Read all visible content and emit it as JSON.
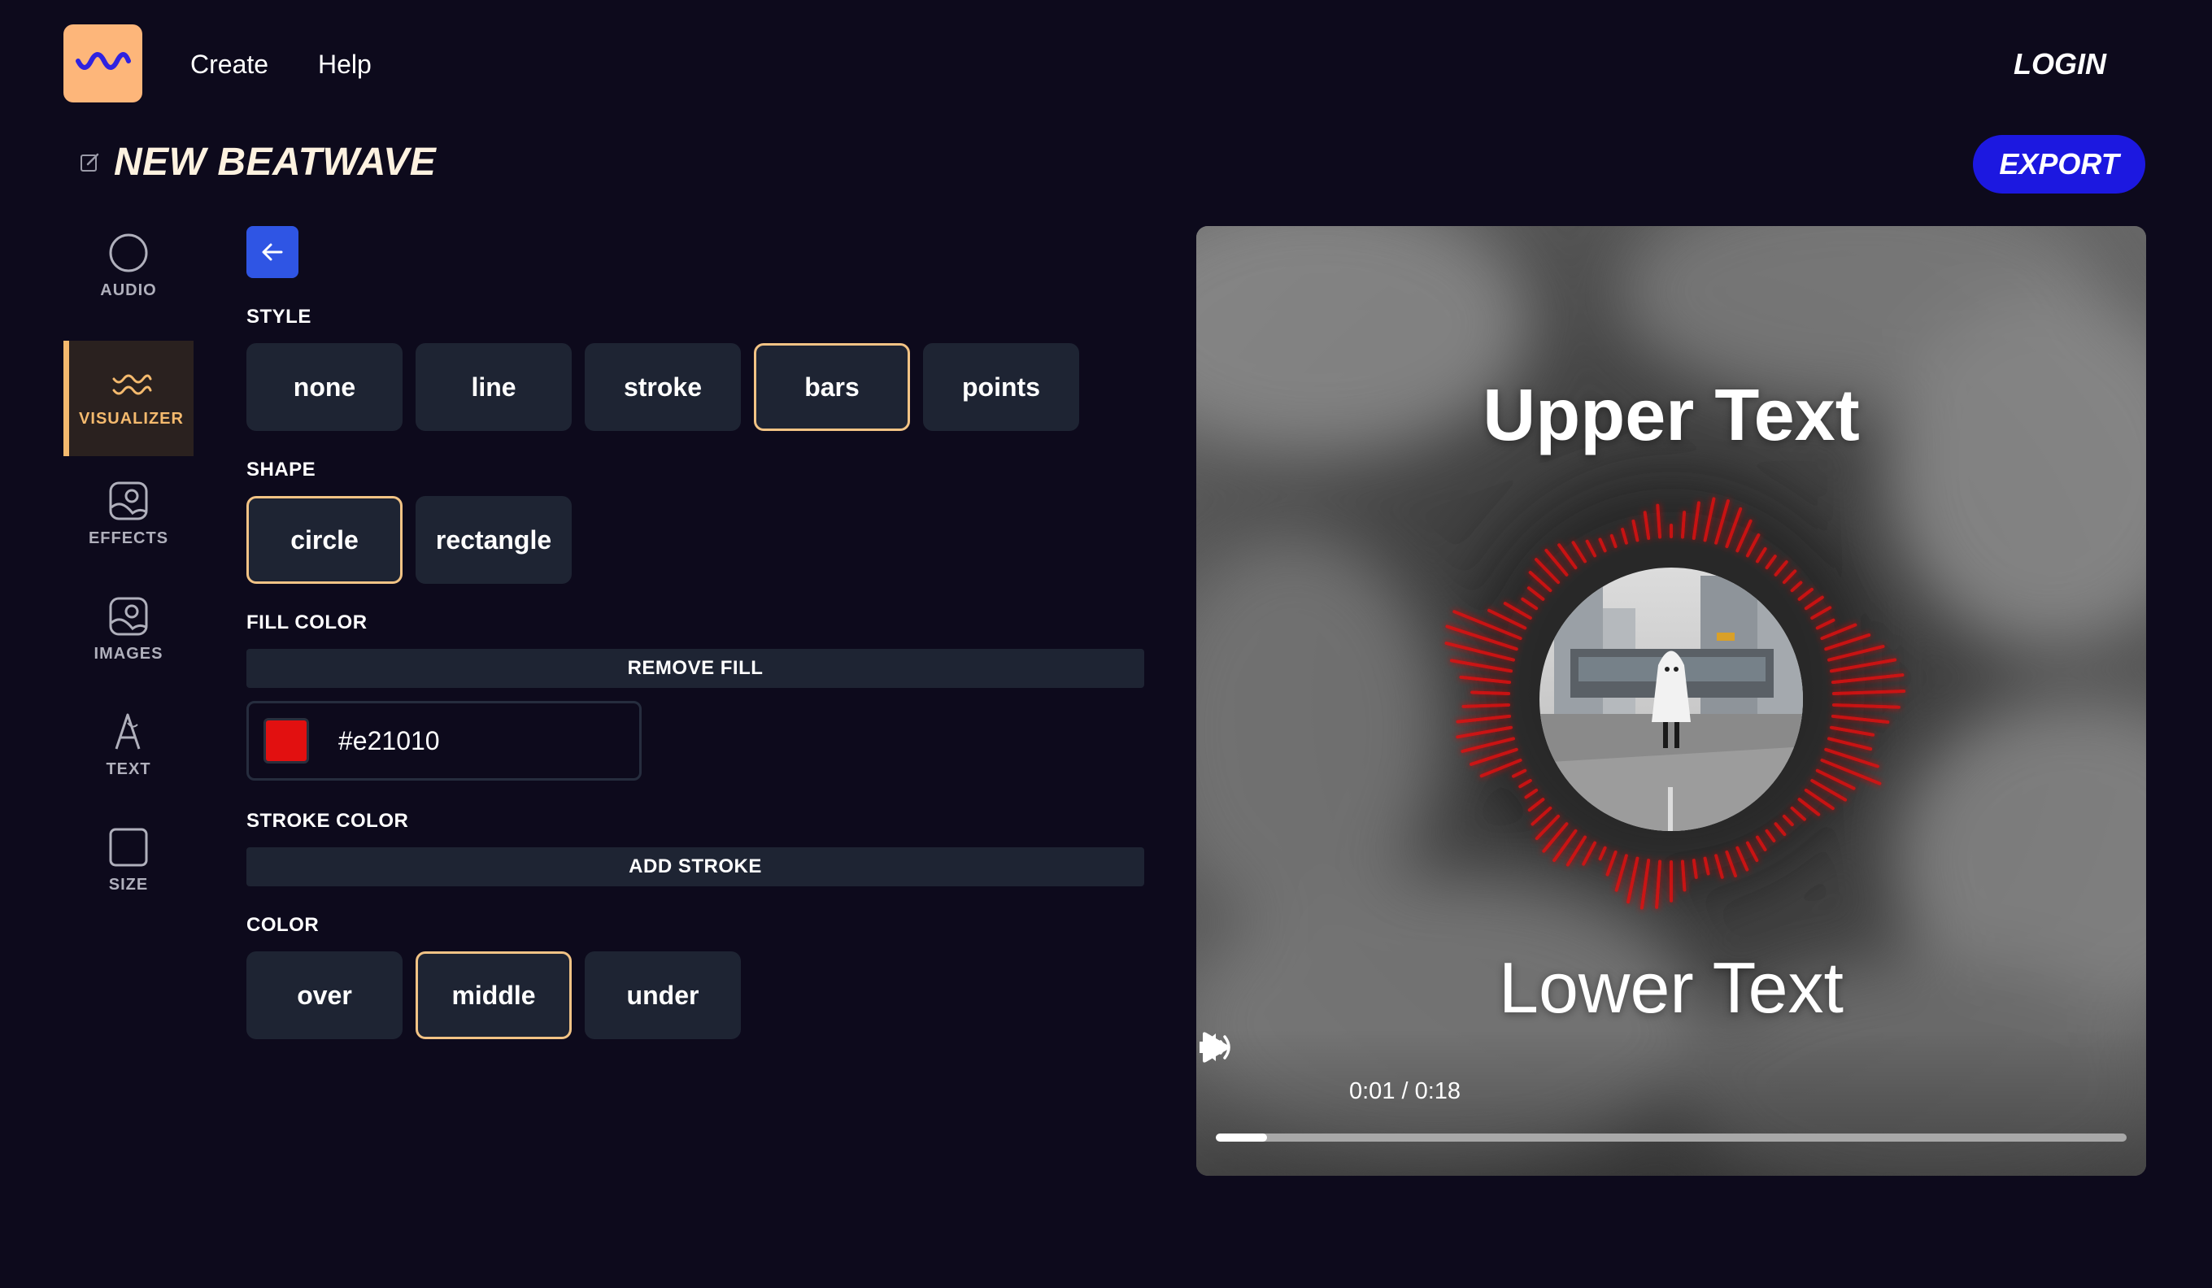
{
  "header": {
    "nav": [
      {
        "label": "Create"
      },
      {
        "label": "Help"
      }
    ],
    "login_label": "LOGIN",
    "logo_icon": "wave-icon",
    "brand_color": "#fdb67a"
  },
  "project": {
    "title": "NEW BEATWAVE",
    "edit_icon": "edit-icon",
    "export_label": "EXPORT"
  },
  "sidebar": {
    "items": [
      {
        "label": "AUDIO",
        "icon": "circle-icon",
        "active": false
      },
      {
        "label": "VISUALIZER",
        "icon": "wave-icon",
        "active": true
      },
      {
        "label": "EFFECTS",
        "icon": "image-icon",
        "active": false
      },
      {
        "label": "IMAGES",
        "icon": "image-icon",
        "active": false
      },
      {
        "label": "TEXT",
        "icon": "font-icon",
        "active": false
      },
      {
        "label": "SIZE",
        "icon": "square-icon",
        "active": false
      }
    ]
  },
  "panel": {
    "back_icon": "arrow-left-icon",
    "style": {
      "label": "STYLE",
      "options": [
        "none",
        "line",
        "stroke",
        "bars",
        "points"
      ],
      "selected": "bars"
    },
    "shape": {
      "label": "SHAPE",
      "options": [
        "circle",
        "rectangle"
      ],
      "selected": "circle"
    },
    "fill_color": {
      "label": "FILL COLOR",
      "remove_label": "REMOVE FILL",
      "value": "#e21010"
    },
    "stroke_color": {
      "label": "STROKE COLOR",
      "add_label": "ADD STROKE"
    },
    "color": {
      "label": "COLOR",
      "options": [
        "over",
        "middle",
        "under"
      ],
      "selected": "middle"
    }
  },
  "preview": {
    "upper_text": "Upper Text",
    "lower_text": "Lower Text",
    "visualizer_color": "#e21010",
    "player": {
      "time": "0:01 / 0:18",
      "progress": 0.056,
      "play_icon": "play-icon",
      "volume_icon": "volume-icon"
    }
  },
  "colors": {
    "background": "#0d0a1c",
    "button_bg": "#1e2433",
    "selected_border": "#f2c385",
    "export_bg": "#1c18e0",
    "back_bg": "#2f55e4"
  }
}
